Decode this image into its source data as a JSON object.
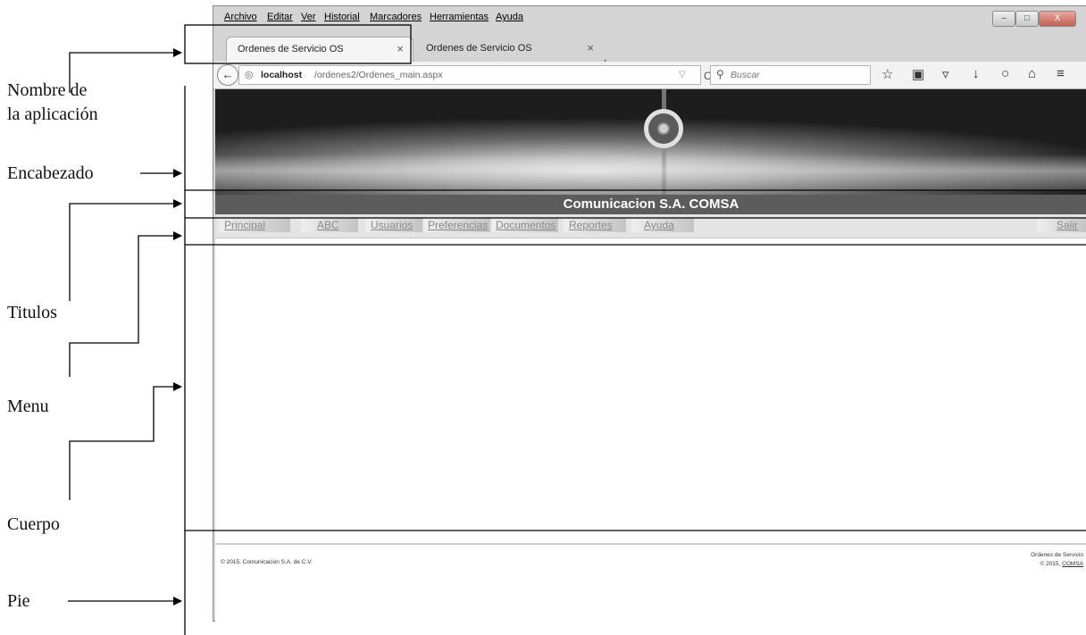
{
  "annotations": {
    "nombre_line1": "Nombre de",
    "nombre_line2": "la aplicación",
    "encabezado": "Encabezado",
    "titulos": "Titulos",
    "menu": "Menu",
    "cuerpo": "Cuerpo",
    "pie": "Pie"
  },
  "browser": {
    "menubar": [
      "Archivo",
      "Editar",
      "Ver",
      "Historial",
      "Marcadores",
      "Herramientas",
      "Ayuda"
    ],
    "tabs": [
      {
        "title": "Ordenes de Servicio OS",
        "close": "×"
      },
      {
        "title": "Ordenes de Servicio OS",
        "close": "×"
      }
    ],
    "new_tab": "+",
    "url_host": "localhost",
    "url_path": "/ordenes2/Ordenes_main.aspx",
    "search_placeholder": "Buscar",
    "toolbar_icons": [
      "star-icon",
      "clipboard-icon",
      "pocket-icon",
      "download-icon",
      "chat-icon",
      "home-icon",
      "menu-icon"
    ]
  },
  "app": {
    "title": "Comunicacion S.A. COMSA",
    "menu": [
      "Principal",
      "ABC",
      "Usuarios",
      "Preferencias",
      "Documentos",
      "Reportes",
      "Ayuda"
    ],
    "exit": "Salir",
    "footer_left": "© 2015, Comunicacion S.A. de C.V.",
    "footer_right_line1": "Ordenes de Servicio",
    "footer_right_prefix": "© 2015, ",
    "footer_right_link": "COMSA"
  }
}
